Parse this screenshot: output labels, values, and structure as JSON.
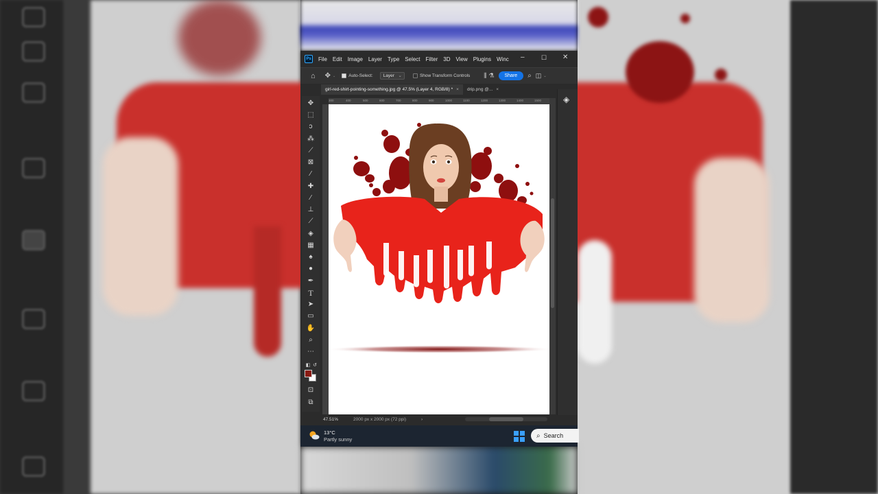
{
  "app": {
    "logo_text": "Ps",
    "menu": [
      "File",
      "Edit",
      "Image",
      "Layer",
      "Type",
      "Select",
      "Filter",
      "3D",
      "View",
      "Plugins",
      "Winc"
    ],
    "window_controls": {
      "minimize": "–",
      "maximize": "☐",
      "close": "✕"
    }
  },
  "options_bar": {
    "auto_select_label": "Auto-Select:",
    "auto_select_checked": true,
    "layer_select_value": "Layer",
    "transform_label": "Show Transform Controls",
    "transform_checked": false,
    "share_label": "Share"
  },
  "tabs": [
    {
      "title": "girl-red-shirt-pointing-something.jpg @ 47.5% (Layer 4, RGB/8) *",
      "close": "×",
      "active": true
    },
    {
      "title": "drip.png @...",
      "close": "×",
      "active": false
    }
  ],
  "ruler_ticks": [
    "300",
    "400",
    "500",
    "600",
    "700",
    "800",
    "900",
    "1000",
    "1100",
    "1200",
    "1300",
    "1400",
    "1500"
  ],
  "tools": [
    "move-tool-icon",
    "marquee-tool-icon",
    "lasso-tool-icon",
    "magic-wand-icon",
    "eyedropper-tool-icon",
    "frame-tool-icon",
    "color-sampler-icon",
    "healing-brush-icon",
    "brush-tool-icon",
    "clone-stamp-icon",
    "history-brush-icon",
    "eraser-tool-icon",
    "gradient-tool-icon",
    "blur-tool-icon",
    "dodge-tool-icon",
    "pen-tool-icon",
    "type-tool-icon",
    "path-select-icon",
    "rectangle-tool-icon",
    "hand-tool-icon",
    "zoom-tool-icon",
    "more-tools-icon"
  ],
  "colors": {
    "foreground": "#8a1a12",
    "background": "#ffffff",
    "shirt": "#e8231b",
    "blood": "#8e0f0f",
    "accent": "#1473e6"
  },
  "status": {
    "zoom": "47.51%",
    "doc_size": "2000 px x 2000 px (72 ppi)",
    "arrow": "›"
  },
  "taskbar": {
    "temp": "13°C",
    "condition": "Partly sunny",
    "search_label": "Search"
  }
}
